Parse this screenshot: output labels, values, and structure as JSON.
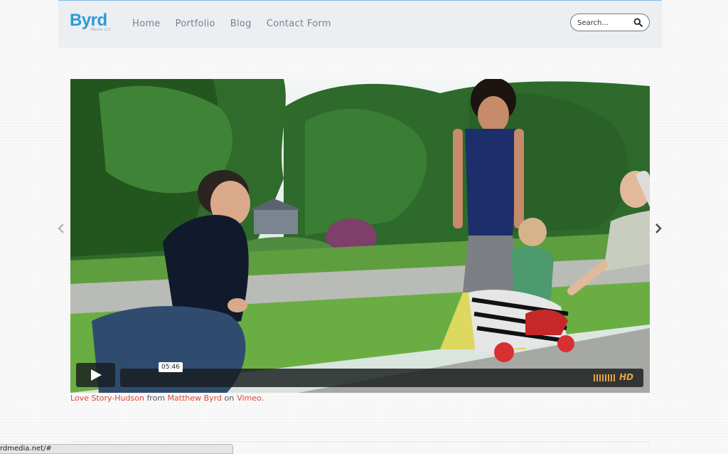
{
  "header": {
    "logo": "Byrd",
    "logo_sub": "Media LLC",
    "nav": [
      "Home",
      "Portfolio",
      "Blog",
      "Contact Form"
    ],
    "search_placeholder": "Search...",
    "search_icon": "search-icon"
  },
  "slider": {
    "prev_icon": "chevron-left-icon",
    "next_icon": "chevron-right-icon"
  },
  "video": {
    "duration": "05:46",
    "hd_label": "HD",
    "play_icon": "play-icon",
    "accent_color": "#e8a33d"
  },
  "caption": {
    "title": "Love Story-Hudson",
    "from_text": "from",
    "author": "Matthew Byrd",
    "on_text": "on",
    "platform": "Vimeo",
    "end": ".",
    "link_color": "#d9473b"
  },
  "status_bar": {
    "url": "rdmedia.net/#"
  }
}
